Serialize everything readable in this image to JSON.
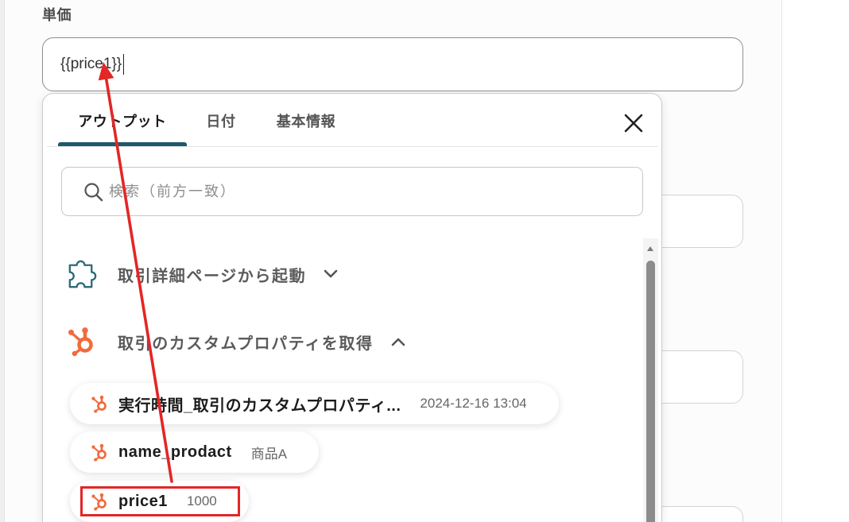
{
  "form": {
    "field_label": "単価",
    "field_value": "{{price1}}"
  },
  "picker": {
    "tabs": [
      {
        "label": "アウトプット",
        "active": true
      },
      {
        "label": "日付",
        "active": false
      },
      {
        "label": "基本情報",
        "active": false
      }
    ],
    "close_icon": "close-icon",
    "search": {
      "icon": "search-icon",
      "placeholder": "検索（前方一致）"
    },
    "groups": [
      {
        "icon": "puzzle-icon",
        "label": "取引詳細ページから起動",
        "expanded": false,
        "chevron": "chevron-down-icon"
      },
      {
        "icon": "hubspot-icon",
        "label": "取引のカスタムプロパティを取得",
        "expanded": true,
        "chevron": "chevron-up-icon",
        "items": [
          {
            "icon": "hubspot-icon",
            "name": "実行時間_取引のカスタムプロパティ...",
            "value": "2024-12-16 13:04"
          },
          {
            "icon": "hubspot-icon",
            "name": "name_prodact",
            "value": "商品A"
          },
          {
            "icon": "hubspot-icon",
            "name": "price1",
            "value": "1000",
            "highlighted": true
          }
        ]
      }
    ],
    "scrollbar": {
      "scroll_fraction": 0
    }
  },
  "colors": {
    "active_tab_indicator": "#1d5a6a",
    "hubspot_icon": "#f26a3d",
    "puzzle_icon": "#2c6b79",
    "annotation_red": "#e32626"
  }
}
